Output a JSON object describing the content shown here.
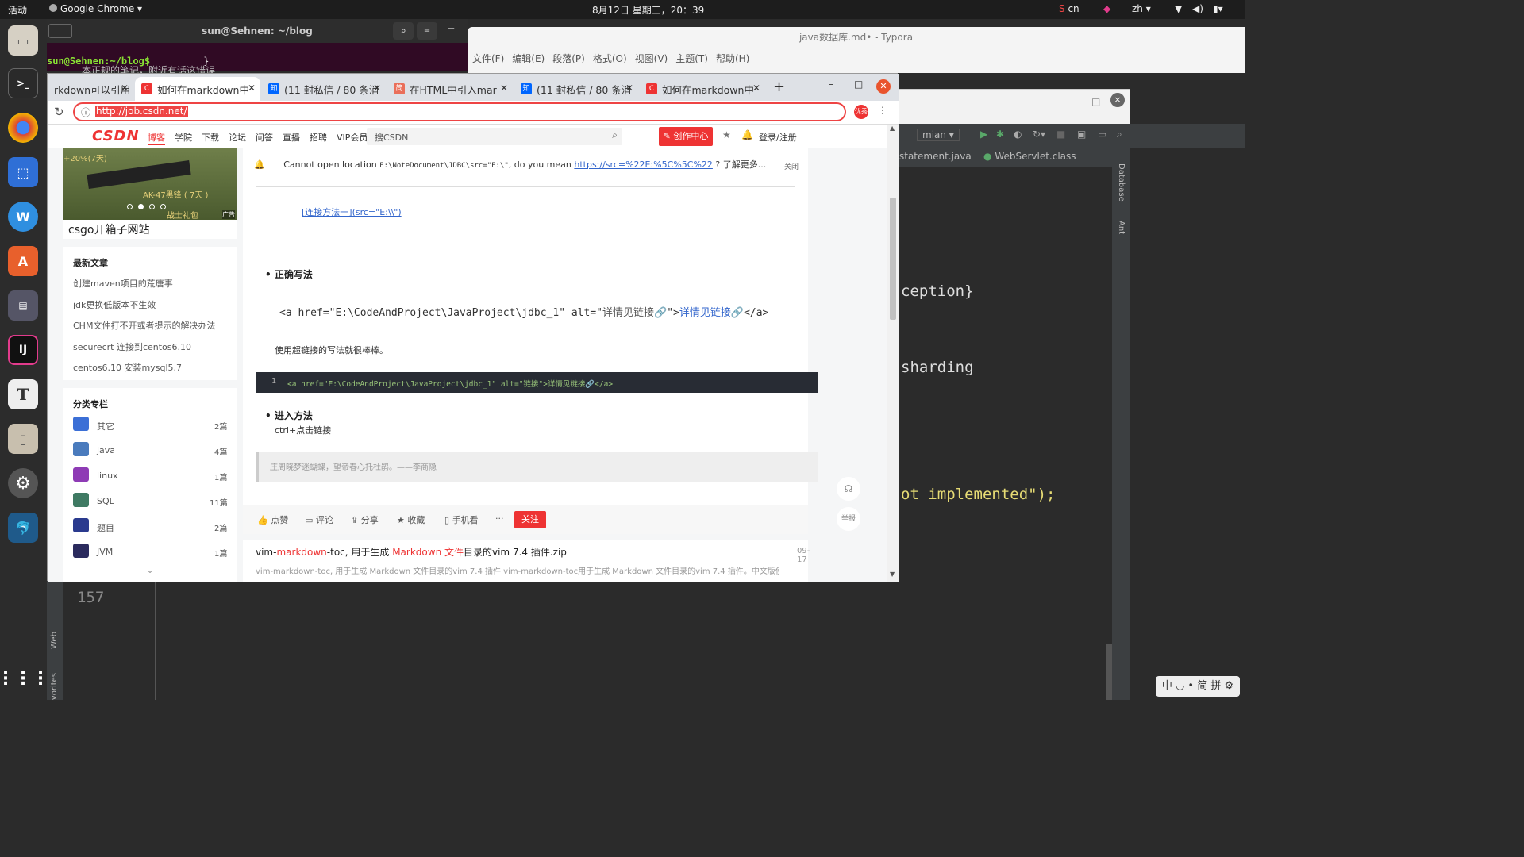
{
  "topbar": {
    "activities": "活动",
    "app": "Google Chrome ▾",
    "clock": "8月12日 星期三，20：39",
    "lang_cn": "cn",
    "lang_zh": "zh ▾"
  },
  "terminal": {
    "title": "sun@Sehnen: ~/blog",
    "prompt": "sun@Sehnen:~/blog$",
    "brace": "}",
    "overflow": "本正规的笔记，附近有话这错误"
  },
  "typora": {
    "title": "java数据库.md• - Typora",
    "menu": [
      "文件(F)",
      "编辑(E)",
      "段落(P)",
      "格式(O)",
      "视图(V)",
      "主题(T)",
      "帮助(H)"
    ],
    "paren": ");"
  },
  "ide": {
    "branch": "mian",
    "tab1": "statement.java",
    "tab2": "WebServlet.class",
    "side1": "Database",
    "side2": "Ant",
    "code1": "ception}",
    "code2": "sharding",
    "code3": "ot implemented\");",
    "line": "157",
    "vert_web": "Web",
    "vert_fav": "vorites"
  },
  "ime": {
    "text": "中 ◡ • 简 拼 ⚙"
  },
  "chrome": {
    "tabs": [
      {
        "label": "rkdown可以引用",
        "fav": "C",
        "favcolor": "#fc5531"
      },
      {
        "label": "如何在markdown中",
        "fav": "C",
        "favcolor": "#e33"
      },
      {
        "label": "(11 封私信 / 80 条消",
        "fav": "知",
        "favcolor": "#0066ff"
      },
      {
        "label": "在HTML中引入mar",
        "fav": "简",
        "favcolor": "#ea6f5a"
      },
      {
        "label": "(11 封私信 / 80 条消",
        "fav": "知",
        "favcolor": "#0066ff"
      },
      {
        "label": "如何在markdown中",
        "fav": "C",
        "favcolor": "#e33"
      }
    ],
    "new_tab": "+",
    "url": "http://job.csdn.net/",
    "profile": "优秀"
  },
  "csdn": {
    "logo": "CSDN",
    "nav": [
      "博客",
      "学院",
      "下载",
      "论坛",
      "问答",
      "直播",
      "招聘",
      "VIP会员"
    ],
    "search_placeholder": "搜CSDN",
    "create": "创作中心",
    "login": "登录/注册",
    "ad": {
      "tag": "+20%(7天)",
      "weapon": "AK-47黑锋 ( 7天 )",
      "sub": "战士礼包",
      "badge": "广告",
      "caption": "csgo开箱子网站"
    },
    "latest": {
      "title": "最新文章",
      "items": [
        "创建maven项目的荒唐事",
        "jdk更换低版本不生效",
        "CHM文件打不开或者提示的解决办法",
        "securecrt 连接到centos6.10",
        "centos6.10 安装mysql5.7"
      ]
    },
    "categories": {
      "title": "分类专栏",
      "items": [
        {
          "name": "其它",
          "count": "2篇",
          "color": "#3b6fd6"
        },
        {
          "name": "java",
          "count": "4篇",
          "color": "#4a7bbd"
        },
        {
          "name": "linux",
          "count": "1篇",
          "color": "#8e3bb5"
        },
        {
          "name": "SQL",
          "count": "11篇",
          "color": "#3f7a63"
        },
        {
          "name": "题目",
          "count": "2篇",
          "color": "#2a3a8e"
        },
        {
          "name": "JVM",
          "count": "1篇",
          "color": "#2b2b5e"
        }
      ],
      "more": "⌄"
    },
    "notice": {
      "text": "Cannot open location ",
      "code": "E:\\NoteDocument\\JDBC\\src=\"E:\\\"",
      "mid": ", do you mean ",
      "link": "https://src=%22E:%5C%5C%22",
      "tail": " ? 了解更多...",
      "close": "关闭"
    },
    "article": {
      "link_line": "[连接方法一](src=\"E:\\\\\")",
      "h_correct": "正确写法",
      "code_html": "<a href=\"E:\\CodeAndProject\\JavaProject\\jdbc_1\" alt=\"",
      "code_alt": "详情见链接",
      "code_close": "\">",
      "code_link": "详情见链接",
      "code_end": "</a>",
      "para": "使用超链接的写法就很棒棒。",
      "block_no": "1",
      "block": "<a href=\"E:\\CodeAndProject\\JavaProject\\jdbc_1\" alt=\"链接\">详情见链接🔗</a>",
      "h_enter": "进入方法",
      "enter_text": "ctrl+点击链接",
      "quote": "庄周晓梦迷蝴蝶，望帝春心托杜鹃。——李商隐"
    },
    "actions": {
      "like": "点赞",
      "comment": "评论",
      "share": "分享",
      "collect": "收藏",
      "phone": "手机看",
      "more": "···",
      "follow": "关注"
    },
    "float": {
      "report": "举报"
    },
    "rec": {
      "title_a": "vim-",
      "title_b": "markdown",
      "title_c": "-toc, 用于生成 ",
      "title_d": "Markdown 文件",
      "title_e": "目录的vim 7.4 插件.zip",
      "date": "09-17",
      "desc": "vim-markdown-toc, 用于生成 Markdown 文件目录的vim 7.4 插件 vim-markdown-toc用于生成 Markdown 文件目录的vim 7.4 插件。中文版使用指"
    }
  }
}
